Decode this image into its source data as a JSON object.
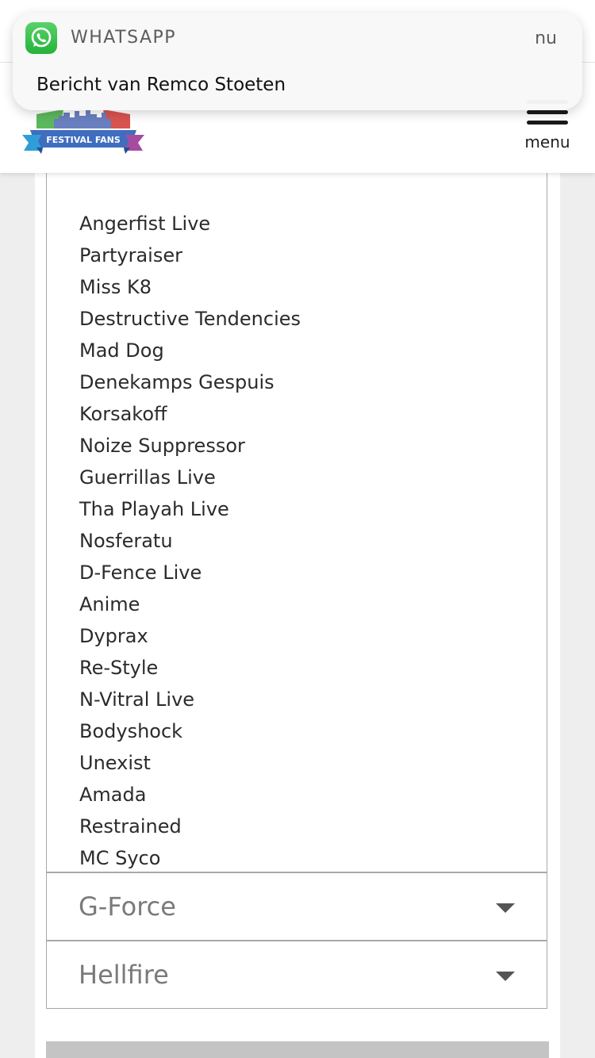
{
  "notification": {
    "app_name": "WHATSAPP",
    "time": "nu",
    "message": "Bericht van Remco Stoeten",
    "icon": "whatsapp-icon",
    "accent_color": "#25D366"
  },
  "header": {
    "logo_text": "FESTIVAL FANS",
    "menu_label": "menu"
  },
  "lineup": {
    "artists": [
      "Angerfist Live",
      "Partyraiser",
      "Miss K8",
      "Destructive Tendencies",
      "Mad Dog",
      "Denekamps Gespuis",
      "Korsakoff",
      "Noize Suppressor",
      "Guerrillas Live",
      "Tha Playah Live",
      "Nosferatu",
      "D-Fence Live",
      "Anime",
      "Dyprax",
      "Re-Style",
      "N-Vitral Live",
      "Bodyshock",
      "Unexist",
      "Amada",
      "Restrained",
      "MC Syco"
    ]
  },
  "accordion": [
    {
      "title": "G-Force",
      "icon": "caret-down-icon"
    },
    {
      "title": "Hellfire",
      "icon": "caret-down-icon"
    }
  ]
}
